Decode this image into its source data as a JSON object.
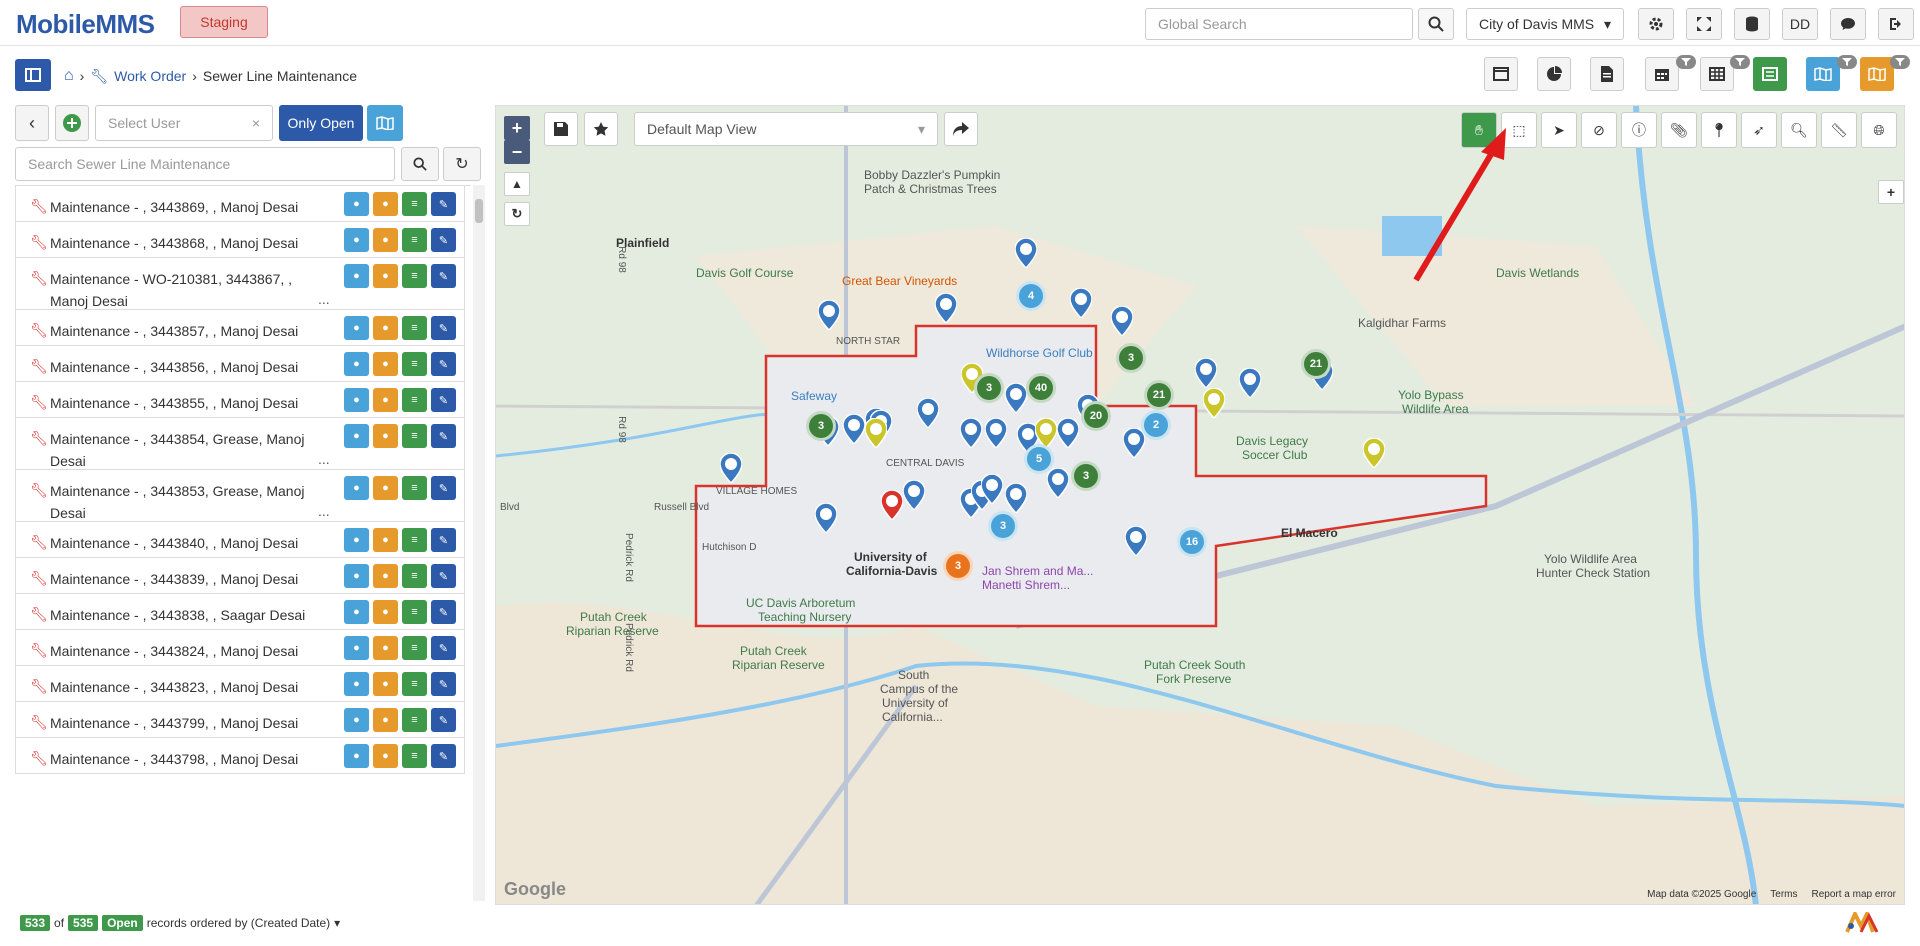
{
  "header": {
    "logo_mobile": "Mobile",
    "logo_mms": "MMS",
    "staging_label": "Staging",
    "search_placeholder": "Global Search",
    "org_select": "City of Davis MMS",
    "user_initials": "DD"
  },
  "breadcrumb": {
    "work_order": "Work Order",
    "current": "Sewer Line Maintenance"
  },
  "panel": {
    "select_user_placeholder": "Select User",
    "only_open_label": "Only Open",
    "search_placeholder": "Search Sewer Line Maintenance",
    "items": [
      {
        "line1": "Maintenance - , 3443869, , Manoj Desai",
        "line2": ""
      },
      {
        "line1": "Maintenance - , 3443868, , Manoj Desai",
        "line2": ""
      },
      {
        "line1": "Maintenance - WO-210381, 3443867, ,",
        "line2": "Manoj Desai"
      },
      {
        "line1": "Maintenance - , 3443857, , Manoj Desai",
        "line2": ""
      },
      {
        "line1": "Maintenance - , 3443856, , Manoj Desai",
        "line2": ""
      },
      {
        "line1": "Maintenance - , 3443855, , Manoj Desai",
        "line2": ""
      },
      {
        "line1": "Maintenance - , 3443854, Grease, Manoj",
        "line2": "Desai"
      },
      {
        "line1": "Maintenance - , 3443853, Grease, Manoj",
        "line2": "Desai"
      },
      {
        "line1": "Maintenance - , 3443840, , Manoj Desai",
        "line2": ""
      },
      {
        "line1": "Maintenance - , 3443839, , Manoj Desai",
        "line2": ""
      },
      {
        "line1": "Maintenance - , 3443838, , Saagar Desai",
        "line2": ""
      },
      {
        "line1": "Maintenance - , 3443824, , Manoj Desai",
        "line2": ""
      },
      {
        "line1": "Maintenance - , 3443823, , Manoj Desai",
        "line2": ""
      },
      {
        "line1": "Maintenance - , 3443799, , Manoj Desai",
        "line2": ""
      },
      {
        "line1": "Maintenance - , 3443798, , Manoj Desai",
        "line2": ""
      }
    ],
    "ellipsis": "...",
    "footer": {
      "shown": "533",
      "of": "of",
      "total": "535",
      "open_badge": "Open",
      "suffix": "records ordered by (Created Date)"
    }
  },
  "map": {
    "view_select": "Default Map View",
    "labels": {
      "pumpkin": "Bobby Dazzler's Pumpkin",
      "pumpkin2": "Patch & Christmas Trees",
      "plainfield": "Plainfield",
      "golf": "Davis Golf Course",
      "vineyards": "Great Bear Vineyards",
      "wetlands": "Davis Wetlands",
      "kalgidhar": "Kalgidhar Farms",
      "northstar": "NORTH STAR",
      "wildhorse": "Wildhorse Golf Club",
      "safeway": "Safeway",
      "central": "CENTRAL DAVIS",
      "village": "VILLAGE HOMES",
      "elmacero": "El Macero",
      "ucd": "University of",
      "ucd2": "California-Davis",
      "arboretum": "UC Davis Arboretum",
      "arboretum2": "Teaching Nursery",
      "putah": "Putah Creek",
      "putah2": "Riparian Reserve",
      "putah3": "Putah Creek",
      "putah4": "Riparian Reserve",
      "southcampus": "South",
      "southcampus2": "Campus of the",
      "southcampus3": "University of",
      "southcampus4": "California...",
      "shrem": "Jan Shrem and Ma...",
      "shrem2": "Manetti Shrem...",
      "putahsouth": "Putah Creek South",
      "putahsouth2": "Fork Preserve",
      "yolo": "Yolo Wildlife Area",
      "yolo2": "Hunter Check Station",
      "yolobypass": "Yolo Bypass",
      "yolobypass2": "Wildlife Area",
      "legacy": "Davis Legacy",
      "legacy2": "Soccer Club",
      "russell": "Russell Blvd",
      "hutchison": "Hutchison D",
      "blvd": "Blvd",
      "rd98": "Rd 98",
      "rd98b": "Rd 98",
      "pedrick": "Pedrick Rd",
      "pedrick2": "Pedrick Rd"
    },
    "clusters": [
      "4",
      "3",
      "40",
      "3",
      "21",
      "20",
      "3",
      "2",
      "5",
      "3",
      "3",
      "16",
      "3",
      "21"
    ],
    "credits": {
      "data": "Map data ©2025 Google",
      "terms": "Terms",
      "report": "Report a map error"
    },
    "google": "Google"
  },
  "colors": {
    "primary": "#2d5aa8",
    "green": "#3e9a4a",
    "orange": "#e59a2b",
    "light_blue": "#4aa3d8",
    "red": "#d9342b"
  }
}
